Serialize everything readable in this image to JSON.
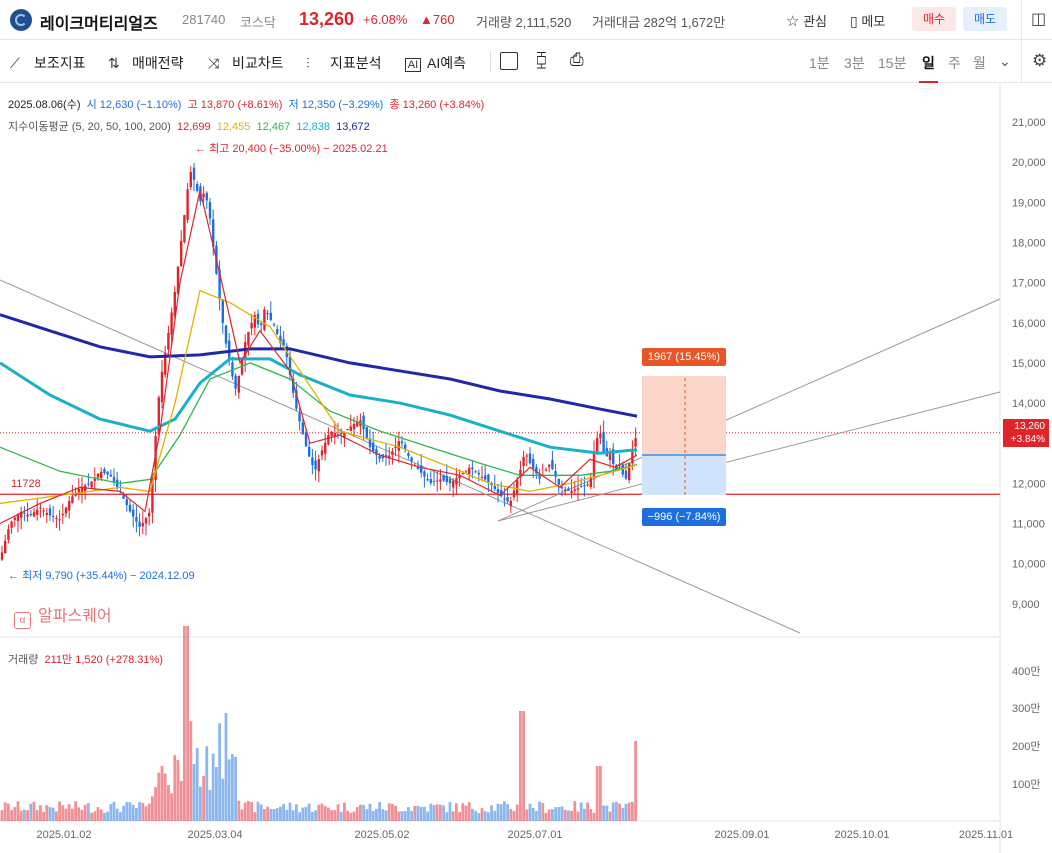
{
  "header": {
    "stock_name": "레이크머티리얼즈",
    "stock_code": "281740",
    "market": "코스닥",
    "price": "13,260",
    "change_pct": "+6.08%",
    "change_amt": "▲760",
    "volume": "거래량 2,111,520",
    "trade_amount": "거래대금 282억 1,672만",
    "fav_label": "관심",
    "memo_label": "메모",
    "buy_label": "매수",
    "sell_label": "매도"
  },
  "toolbar": {
    "tools": [
      "보조지표",
      "매매전략",
      "비교차트",
      "지표분석",
      "AI예측"
    ],
    "periods": [
      "1분",
      "3분",
      "15분",
      "일",
      "주",
      "월"
    ],
    "selected_period": "일"
  },
  "ohlc": {
    "date": "2025.08.06(수)",
    "open": "시 12,630 (−1.10%)",
    "high": "고 13,870 (+8.61%)",
    "low": "저 12,350 (−3.29%)",
    "close": "종 13,260 (+3.84%)"
  },
  "ma": {
    "label": "지수이동평균 (5, 20, 50, 100, 200)",
    "values": [
      "12,699",
      "12,455",
      "12,467",
      "12,838",
      "13,672"
    ],
    "colors": [
      "#e0242c",
      "#e0b300",
      "#2db84a",
      "#1ab0c9",
      "#1f28a8"
    ]
  },
  "annotations": {
    "high": "최고 20,400 (−35.00%) − 2025.02.21",
    "low": "최저 9,790 (+35.44%) − 2024.12.09",
    "level": "11728",
    "upper_box": "1967 (15.45%)",
    "lower_box": "−996 (−7.84%)",
    "price_tag_price": "13,260",
    "price_tag_pct": "+3.84%"
  },
  "y_axis": [
    "21,000",
    "20,000",
    "19,000",
    "18,000",
    "17,000",
    "16,000",
    "15,000",
    "14,000",
    "12,000",
    "11,000",
    "10,000",
    "9,000"
  ],
  "x_axis": [
    "2025.01.02",
    "2025.03.04",
    "2025.05.02",
    "2025.07.01",
    "2025.09.01",
    "2025.10.01",
    "2025.11.01"
  ],
  "volume": {
    "label": "거래량",
    "value": "211만 1,520 (+278.31%)",
    "axis": [
      "400만",
      "300만",
      "200만",
      "100만"
    ]
  },
  "watermark": "알파스퀘어",
  "colors": {
    "up": "#e0242c",
    "down": "#1d6fe0",
    "accent": "#e0242c"
  }
}
